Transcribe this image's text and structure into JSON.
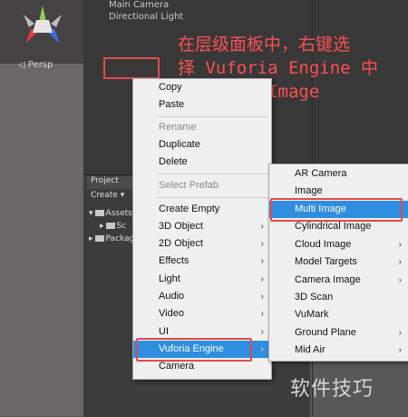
{
  "scene": {
    "persp_label": "◁ Persp"
  },
  "hierarchy": {
    "items": [
      "Main Camera",
      "Directional Light"
    ]
  },
  "project": {
    "tab": "Project",
    "create": "Create ▾",
    "tree": [
      {
        "label": "Assets",
        "expanded": true
      },
      {
        "label": "Sc",
        "expanded": false
      },
      {
        "label": "Packages",
        "expanded": false
      }
    ]
  },
  "annotation": {
    "lines": [
      "在层级面板中，右键选",
      "择 Vuforia Engine 中",
      "的 Multi Image"
    ]
  },
  "context_menu": {
    "items": [
      {
        "label": "Copy",
        "disabled": false,
        "submenu": false
      },
      {
        "label": "Paste",
        "disabled": false,
        "submenu": false
      },
      {
        "label": "Rename",
        "disabled": true,
        "submenu": false
      },
      {
        "label": "Duplicate",
        "disabled": false,
        "submenu": false
      },
      {
        "label": "Delete",
        "disabled": false,
        "submenu": false
      },
      {
        "label": "Select Prefab",
        "disabled": true,
        "submenu": false
      },
      {
        "label": "Create Empty",
        "disabled": false,
        "submenu": false
      },
      {
        "label": "3D Object",
        "disabled": false,
        "submenu": true
      },
      {
        "label": "2D Object",
        "disabled": false,
        "submenu": true
      },
      {
        "label": "Effects",
        "disabled": false,
        "submenu": true
      },
      {
        "label": "Light",
        "disabled": false,
        "submenu": true
      },
      {
        "label": "Audio",
        "disabled": false,
        "submenu": true
      },
      {
        "label": "Video",
        "disabled": false,
        "submenu": true
      },
      {
        "label": "UI",
        "disabled": false,
        "submenu": true
      },
      {
        "label": "Vuforia Engine",
        "disabled": false,
        "submenu": true,
        "selected": true
      },
      {
        "label": "Camera",
        "disabled": false,
        "submenu": false
      }
    ]
  },
  "vuforia_menu": {
    "items": [
      {
        "label": "AR Camera",
        "submenu": false
      },
      {
        "label": "Image",
        "submenu": false
      },
      {
        "label": "Multi Image",
        "submenu": false,
        "selected": true
      },
      {
        "label": "Cylindrical Image",
        "submenu": false
      },
      {
        "label": "Cloud Image",
        "submenu": true
      },
      {
        "label": "Model Targets",
        "submenu": true
      },
      {
        "label": "Camera Image",
        "submenu": true
      },
      {
        "label": "3D Scan",
        "submenu": false
      },
      {
        "label": "VuMark",
        "submenu": false
      },
      {
        "label": "Ground Plane",
        "submenu": true
      },
      {
        "label": "Mid Air",
        "submenu": true
      }
    ]
  },
  "watermark": "软件技巧",
  "colors": {
    "highlight": "#e34b4b",
    "selection": "#2f8ee0",
    "annotation": "#ff4f4f"
  }
}
